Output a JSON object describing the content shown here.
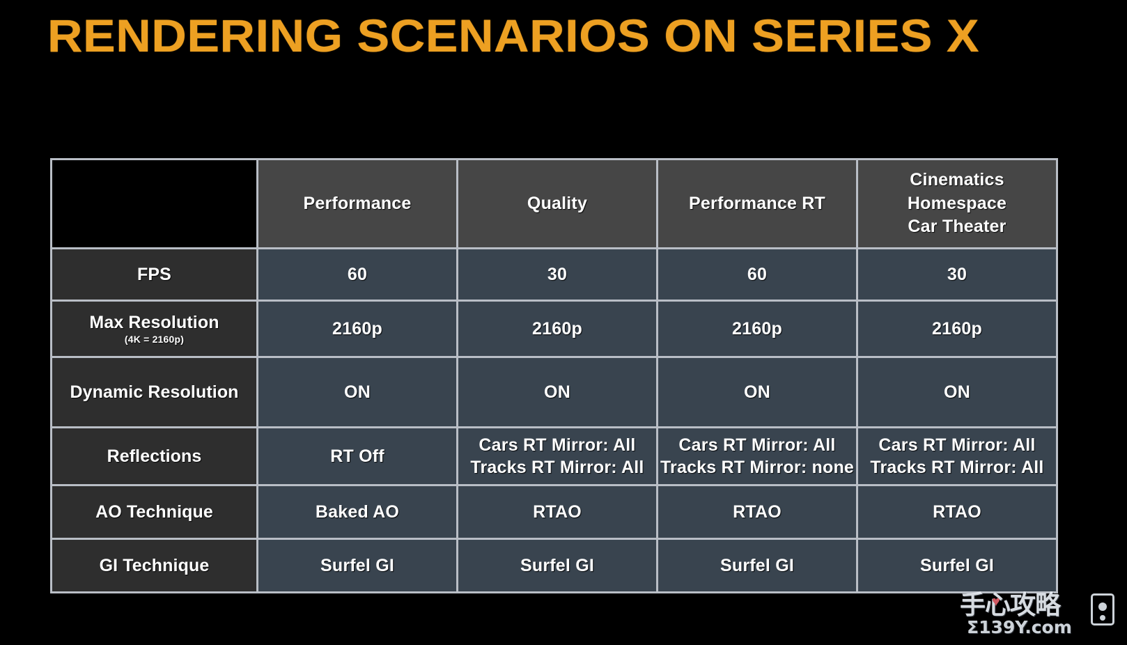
{
  "slide": {
    "title": "RENDERING SCENARIOS ON SERIES X",
    "title_color": "#eda022",
    "background_color": "#000000"
  },
  "table": {
    "corner_label": "",
    "column_headers": [
      {
        "lines": [
          "Performance"
        ]
      },
      {
        "lines": [
          "Quality"
        ]
      },
      {
        "lines": [
          "Performance RT"
        ]
      },
      {
        "lines": [
          "Cinematics",
          "Homespace",
          "Car Theater"
        ]
      }
    ],
    "rows": [
      {
        "label": "FPS",
        "sublabel": "",
        "cells": [
          {
            "lines": [
              "60"
            ]
          },
          {
            "lines": [
              "30"
            ]
          },
          {
            "lines": [
              "60"
            ]
          },
          {
            "lines": [
              "30"
            ]
          }
        ]
      },
      {
        "label": "Max Resolution",
        "sublabel": "(4K = 2160p)",
        "cells": [
          {
            "lines": [
              "2160p"
            ]
          },
          {
            "lines": [
              "2160p"
            ]
          },
          {
            "lines": [
              "2160p"
            ]
          },
          {
            "lines": [
              "2160p"
            ]
          }
        ]
      },
      {
        "label": "Dynamic Resolution",
        "sublabel": "",
        "cells": [
          {
            "lines": [
              "ON"
            ]
          },
          {
            "lines": [
              "ON"
            ]
          },
          {
            "lines": [
              "ON"
            ]
          },
          {
            "lines": [
              "ON"
            ]
          }
        ]
      },
      {
        "label": "Reflections",
        "sublabel": "",
        "cells": [
          {
            "lines": [
              "RT Off"
            ]
          },
          {
            "lines": [
              "Cars RT Mirror: All",
              "Tracks RT Mirror: All"
            ]
          },
          {
            "lines": [
              "Cars RT Mirror: All",
              "Tracks RT Mirror: none"
            ]
          },
          {
            "lines": [
              "Cars RT Mirror: All",
              "Tracks RT Mirror: All"
            ]
          }
        ]
      },
      {
        "label": "AO Technique",
        "sublabel": "",
        "cells": [
          {
            "lines": [
              "Baked AO"
            ]
          },
          {
            "lines": [
              "RTAO"
            ]
          },
          {
            "lines": [
              "RTAO"
            ]
          },
          {
            "lines": [
              "RTAO"
            ]
          }
        ]
      },
      {
        "label": "GI Technique",
        "sublabel": "",
        "cells": [
          {
            "lines": [
              "Surfel GI"
            ]
          },
          {
            "lines": [
              "Surfel GI"
            ]
          },
          {
            "lines": [
              "Surfel GI"
            ]
          },
          {
            "lines": [
              "Surfel GI"
            ]
          }
        ]
      }
    ],
    "colors": {
      "header_cell": "#464646",
      "row_label_cell": "#2e2e2e",
      "data_cell": "#39444f",
      "gridline": "#b9bec6",
      "corner_cell": "#000000",
      "text": "#ffffff"
    }
  },
  "watermark": {
    "main_text": "手心攻略",
    "sub_text": "Σ139Y.com",
    "heart_glyph": "♥",
    "icon": "phone-icon"
  }
}
